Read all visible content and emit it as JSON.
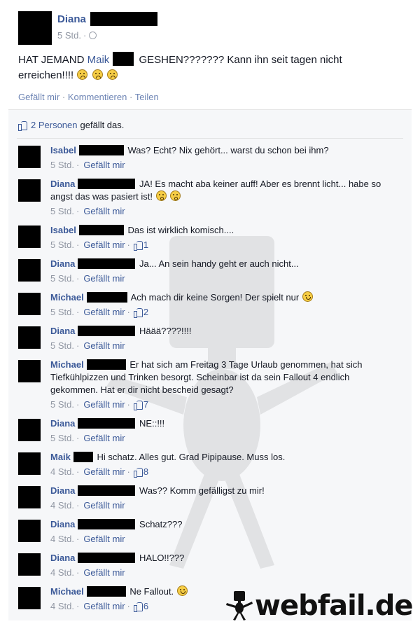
{
  "post": {
    "author": "Diana",
    "time": "5 Std.",
    "body_pre": "HAT JEMAND ",
    "mention": "Maik",
    "body_post": " GESHEN??????? Kann ihn seit tagen nicht erreichen!!!!",
    "actions": {
      "like": "Gefällt mir",
      "comment": "Kommentieren",
      "share": "Teilen"
    }
  },
  "likes": {
    "people": "2 Personen",
    "suffix": "gefällt das."
  },
  "comments": [
    {
      "author": "Isabel",
      "text": "Was? Echt? Nix gehört... warst du schon bei ihm?",
      "time": "5 Std.",
      "like_label": "Gefällt mir",
      "likes": ""
    },
    {
      "author": "Diana",
      "text": "JA! Es macht aba keiner auff! Aber es brennt licht... habe so angst das was pasiert ist!",
      "time": "5 Std.",
      "like_label": "Gefällt mir",
      "likes": ""
    },
    {
      "author": "Isabel",
      "text": "Das ist wirklich komisch....",
      "time": "5 Std.",
      "like_label": "Gefällt mir",
      "likes": "1"
    },
    {
      "author": "Diana",
      "text": "Ja... An sein handy geht er auch nicht...",
      "time": "5 Std.",
      "like_label": "Gefällt mir",
      "likes": ""
    },
    {
      "author": "Michael",
      "text": "Ach mach dir keine Sorgen! Der spielt nur",
      "time": "5 Std.",
      "like_label": "Gefällt mir",
      "likes": "2"
    },
    {
      "author": "Diana",
      "text": "Häää????!!!!",
      "time": "5 Std.",
      "like_label": "Gefällt mir",
      "likes": ""
    },
    {
      "author": "Michael",
      "text": "Er hat sich am Freitag 3 Tage Urlaub genommen, hat sich Tiefkühlpizzen und Trinken besorgt. Scheinbar ist da sein Fallout 4 endlich gekommen. Hat er dir nicht bescheid gesagt?",
      "time": "5 Std.",
      "like_label": "Gefällt mir",
      "likes": "7"
    },
    {
      "author": "Diana",
      "text": "NE::!!!",
      "time": "5 Std.",
      "like_label": "Gefällt mir",
      "likes": ""
    },
    {
      "author": "Maik",
      "text": "Hi schatz. Alles gut. Grad Pipipause. Muss los.",
      "time": "4 Std.",
      "like_label": "Gefällt mir",
      "likes": "8"
    },
    {
      "author": "Diana",
      "text": "Was?? Komm gefälligst zu mir!",
      "time": "4 Std.",
      "like_label": "Gefällt mir",
      "likes": ""
    },
    {
      "author": "Diana",
      "text": "Schatz???",
      "time": "4 Std.",
      "like_label": "Gefällt mir",
      "likes": ""
    },
    {
      "author": "Diana",
      "text": "HALO!!???",
      "time": "4 Std.",
      "like_label": "Gefällt mir",
      "likes": ""
    },
    {
      "author": "Michael",
      "text": "Ne Fallout.",
      "time": "4 Std.",
      "like_label": "Gefällt mir",
      "likes": "6"
    }
  ],
  "watermark": {
    "text": "webfail.de"
  },
  "icons": {
    "like": "thumbs-up-icon",
    "audience": "globe-icon",
    "emoji_sad": "sad-emoji-icon",
    "emoji_wow": "surprised-emoji-icon",
    "emoji_smile": "smile-emoji-icon"
  },
  "colors": {
    "link": "#3b5998",
    "meta": "#9197a3",
    "panel": "#f6f7f9"
  }
}
